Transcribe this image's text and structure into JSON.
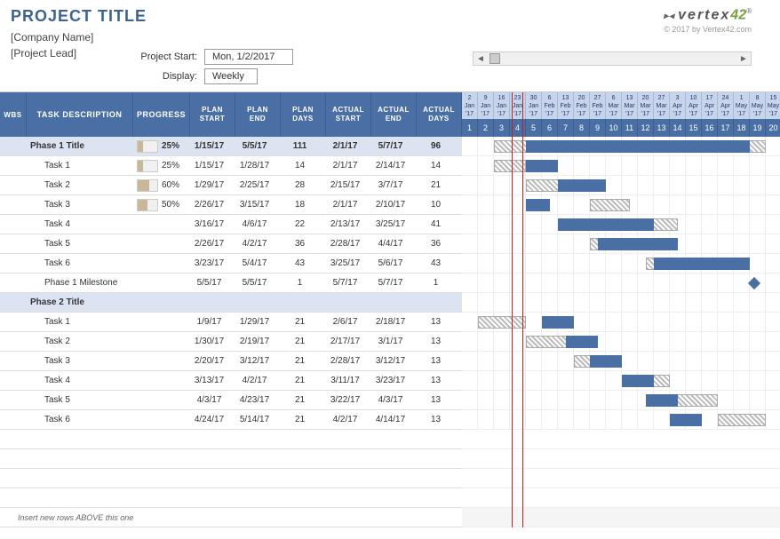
{
  "header": {
    "title": "PROJECT TITLE",
    "company": "[Company Name]",
    "lead": "[Project Lead]",
    "project_start_label": "Project Start:",
    "project_start_value": "Mon, 1/2/2017",
    "display_label": "Display:",
    "display_value": "Weekly",
    "logo_text": "vertex",
    "logo_suffix": "42",
    "copyright": "© 2017 by Vertex42.com"
  },
  "columns": {
    "wbs": "WBS",
    "task": "TASK DESCRIPTION",
    "progress": "PROGRESS",
    "plan_start": "PLAN START",
    "plan_end": "PLAN END",
    "plan_days": "PLAN DAYS",
    "actual_start": "ACTUAL START",
    "actual_end": "ACTUAL END",
    "actual_days": "ACTUAL DAYS"
  },
  "timeline": {
    "dates": [
      {
        "d": "2",
        "m": "Jan",
        "y": "'17"
      },
      {
        "d": "9",
        "m": "Jan",
        "y": "'17"
      },
      {
        "d": "16",
        "m": "Jan",
        "y": "'17"
      },
      {
        "d": "23",
        "m": "Jan",
        "y": "'17"
      },
      {
        "d": "30",
        "m": "Jan",
        "y": "'17"
      },
      {
        "d": "6",
        "m": "Feb",
        "y": "'17"
      },
      {
        "d": "13",
        "m": "Feb",
        "y": "'17"
      },
      {
        "d": "20",
        "m": "Feb",
        "y": "'17"
      },
      {
        "d": "27",
        "m": "Feb",
        "y": "'17"
      },
      {
        "d": "6",
        "m": "Mar",
        "y": "'17"
      },
      {
        "d": "13",
        "m": "Mar",
        "y": "'17"
      },
      {
        "d": "20",
        "m": "Mar",
        "y": "'17"
      },
      {
        "d": "27",
        "m": "Mar",
        "y": "'17"
      },
      {
        "d": "3",
        "m": "Apr",
        "y": "'17"
      },
      {
        "d": "10",
        "m": "Apr",
        "y": "'17"
      },
      {
        "d": "17",
        "m": "Apr",
        "y": "'17"
      },
      {
        "d": "24",
        "m": "Apr",
        "y": "'17"
      },
      {
        "d": "1",
        "m": "May",
        "y": "'17"
      },
      {
        "d": "8",
        "m": "May",
        "y": "'17"
      },
      {
        "d": "15",
        "m": "May",
        "y": "'17"
      }
    ],
    "weeks": [
      "1",
      "2",
      "3",
      "4",
      "5",
      "6",
      "7",
      "8",
      "9",
      "10",
      "11",
      "12",
      "13",
      "14",
      "15",
      "16",
      "17",
      "18",
      "19",
      "20"
    ]
  },
  "rows": [
    {
      "type": "phase",
      "task": "Phase 1 Title",
      "progress": "25%",
      "prog_pct": 25,
      "ps": "1/15/17",
      "pe": "5/5/17",
      "pd": "111",
      "as": "2/1/17",
      "ae": "5/7/17",
      "ad": "96",
      "plan_bar": [
        2,
        17
      ],
      "actual_bar": [
        4,
        14
      ]
    },
    {
      "type": "task",
      "task": "Task 1",
      "progress": "25%",
      "prog_pct": 25,
      "ps": "1/15/17",
      "pe": "1/28/17",
      "pd": "14",
      "as": "2/1/17",
      "ae": "2/14/17",
      "ad": "14",
      "plan_bar": [
        2,
        2
      ],
      "actual_bar": [
        4,
        2
      ]
    },
    {
      "type": "task",
      "task": "Task 2",
      "progress": "60%",
      "prog_pct": 60,
      "ps": "1/29/17",
      "pe": "2/25/17",
      "pd": "28",
      "as": "2/15/17",
      "ae": "3/7/17",
      "ad": "21",
      "plan_bar": [
        4,
        4
      ],
      "actual_bar": [
        6,
        3
      ]
    },
    {
      "type": "task",
      "task": "Task 3",
      "progress": "50%",
      "prog_pct": 50,
      "ps": "2/26/17",
      "pe": "3/15/17",
      "pd": "18",
      "as": "2/1/17",
      "ae": "2/10/17",
      "ad": "10",
      "plan_bar": [
        8,
        2.5
      ],
      "actual_bar": [
        4,
        1.5
      ]
    },
    {
      "type": "task",
      "task": "Task 4",
      "progress": "",
      "prog_pct": 0,
      "ps": "3/16/17",
      "pe": "4/6/17",
      "pd": "22",
      "as": "2/13/17",
      "ae": "3/25/17",
      "ad": "41",
      "plan_bar": [
        10.5,
        3
      ],
      "actual_bar": [
        6,
        6
      ]
    },
    {
      "type": "task",
      "task": "Task 5",
      "progress": "",
      "prog_pct": 0,
      "ps": "2/26/17",
      "pe": "4/2/17",
      "pd": "36",
      "as": "2/28/17",
      "ae": "4/4/17",
      "ad": "36",
      "plan_bar": [
        8,
        5
      ],
      "actual_bar": [
        8.5,
        5
      ]
    },
    {
      "type": "task",
      "task": "Task 6",
      "progress": "",
      "prog_pct": 0,
      "ps": "3/23/17",
      "pe": "5/4/17",
      "pd": "43",
      "as": "3/25/17",
      "ae": "5/6/17",
      "ad": "43",
      "plan_bar": [
        11.5,
        6
      ],
      "actual_bar": [
        12,
        6
      ]
    },
    {
      "type": "task",
      "task": "Phase 1 Milestone",
      "progress": "",
      "prog_pct": 0,
      "ps": "5/5/17",
      "pe": "5/5/17",
      "pd": "1",
      "as": "5/7/17",
      "ae": "5/7/17",
      "ad": "1",
      "milestone": 18
    },
    {
      "type": "phase",
      "task": "Phase 2 Title",
      "progress": "",
      "prog_pct": 0,
      "ps": "",
      "pe": "",
      "pd": "",
      "as": "",
      "ae": "",
      "ad": ""
    },
    {
      "type": "task",
      "task": "Task 1",
      "progress": "",
      "prog_pct": 0,
      "ps": "1/9/17",
      "pe": "1/29/17",
      "pd": "21",
      "as": "2/6/17",
      "ae": "2/18/17",
      "ad": "13",
      "plan_bar": [
        1,
        3
      ],
      "actual_bar": [
        5,
        2
      ]
    },
    {
      "type": "task",
      "task": "Task 2",
      "progress": "",
      "prog_pct": 0,
      "ps": "1/30/17",
      "pe": "2/19/17",
      "pd": "21",
      "as": "2/17/17",
      "ae": "3/1/17",
      "ad": "13",
      "plan_bar": [
        4,
        3
      ],
      "actual_bar": [
        6.5,
        2
      ]
    },
    {
      "type": "task",
      "task": "Task 3",
      "progress": "",
      "prog_pct": 0,
      "ps": "2/20/17",
      "pe": "3/12/17",
      "pd": "21",
      "as": "2/28/17",
      "ae": "3/12/17",
      "ad": "13",
      "plan_bar": [
        7,
        3
      ],
      "actual_bar": [
        8,
        2
      ]
    },
    {
      "type": "task",
      "task": "Task 4",
      "progress": "",
      "prog_pct": 0,
      "ps": "3/13/17",
      "pe": "4/2/17",
      "pd": "21",
      "as": "3/11/17",
      "ae": "3/23/17",
      "ad": "13",
      "plan_bar": [
        10,
        3
      ],
      "actual_bar": [
        10,
        2
      ]
    },
    {
      "type": "task",
      "task": "Task 5",
      "progress": "",
      "prog_pct": 0,
      "ps": "4/3/17",
      "pe": "4/23/17",
      "pd": "21",
      "as": "3/22/17",
      "ae": "4/3/17",
      "ad": "13",
      "plan_bar": [
        13,
        3
      ],
      "actual_bar": [
        11.5,
        2
      ]
    },
    {
      "type": "task",
      "task": "Task 6",
      "progress": "",
      "prog_pct": 0,
      "ps": "4/24/17",
      "pe": "5/14/17",
      "pd": "21",
      "as": "4/2/17",
      "ae": "4/14/17",
      "ad": "13",
      "plan_bar": [
        16,
        3
      ],
      "actual_bar": [
        13,
        2
      ]
    }
  ],
  "footer_note": "Insert new rows ABOVE this one"
}
